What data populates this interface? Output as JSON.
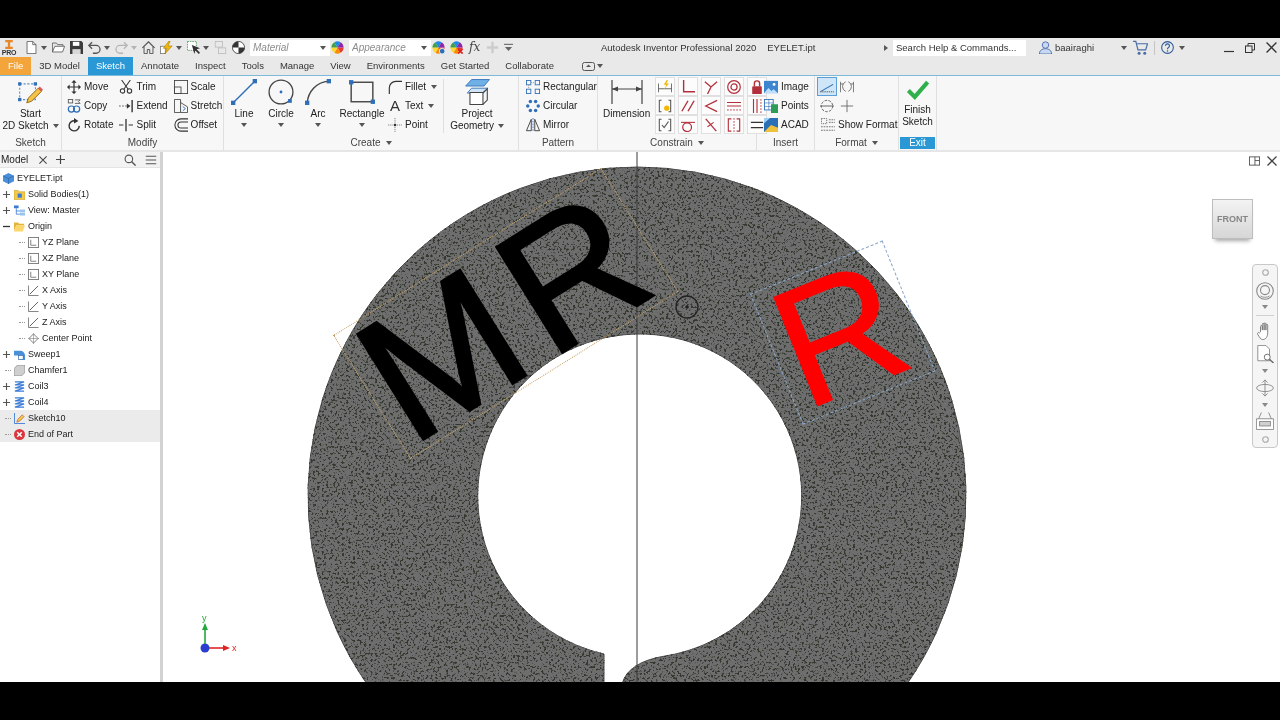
{
  "window": {
    "edition_badge": "PRO",
    "title": "Autodesk Inventor Professional 2020",
    "document": "EYELET.ipt"
  },
  "quick_access": [
    {
      "kind": "button",
      "disabled": false,
      "dropdown": true
    },
    {
      "kind": "button",
      "disabled": false,
      "dropdown": false
    },
    {
      "kind": "button",
      "disabled": false,
      "dropdown": false
    },
    {
      "kind": "button",
      "disabled": false,
      "dropdown": true
    },
    {
      "kind": "button",
      "disabled": true,
      "dropdown": true
    },
    {
      "kind": "button",
      "disabled": false,
      "dropdown": false
    },
    {
      "kind": "button",
      "disabled": false,
      "dropdown": true
    },
    {
      "kind": "button",
      "disabled": false,
      "dropdown": true
    },
    {
      "kind": "button",
      "disabled": true,
      "dropdown": false
    },
    {
      "kind": "button",
      "disabled": false,
      "dropdown": false
    },
    {
      "kind": "combo",
      "placeholder": "Material"
    },
    {
      "kind": "button",
      "disabled": false,
      "dropdown": false
    },
    {
      "kind": "combo",
      "placeholder": "Appearance"
    },
    {
      "kind": "button",
      "disabled": false,
      "dropdown": false
    },
    {
      "kind": "button",
      "disabled": false,
      "dropdown": false
    },
    {
      "kind": "glyph",
      "label": "fx"
    },
    {
      "kind": "button",
      "disabled": true,
      "dropdown": false
    },
    {
      "kind": "menu"
    }
  ],
  "search": {
    "placeholder": "Search Help & Commands..."
  },
  "account": {
    "user": "baairaghi"
  },
  "tabs": [
    {
      "kind": "file",
      "label": "File",
      "selected": false
    },
    {
      "kind": "tab",
      "label": "3D Model",
      "selected": false
    },
    {
      "kind": "tab",
      "label": "Sketch",
      "selected": true
    },
    {
      "kind": "tab",
      "label": "Annotate",
      "selected": false
    },
    {
      "kind": "tab",
      "label": "Inspect",
      "selected": false
    },
    {
      "kind": "tab",
      "label": "Tools",
      "selected": false
    },
    {
      "kind": "tab",
      "label": "Manage",
      "selected": false
    },
    {
      "kind": "tab",
      "label": "View",
      "selected": false
    },
    {
      "kind": "tab",
      "label": "Environments",
      "selected": false
    },
    {
      "kind": "tab",
      "label": "Get Started",
      "selected": false
    },
    {
      "kind": "tab",
      "label": "Collaborate",
      "selected": false
    }
  ],
  "ribbon": [
    {
      "kind": "standard",
      "title": "Sketch",
      "menu": false,
      "tools": [
        {
          "kind": "stacked",
          "label": "Start\n2D Sketch",
          "dropdown": true
        }
      ]
    },
    {
      "kind": "standard",
      "title": "Modify",
      "menu": false,
      "tools": [
        {
          "kind": "small",
          "label": "Move",
          "dropdown": false
        },
        {
          "kind": "small",
          "label": "Copy",
          "dropdown": false
        },
        {
          "kind": "small",
          "label": "Rotate",
          "dropdown": false
        },
        {
          "kind": "small",
          "label": "Trim",
          "dropdown": false
        },
        {
          "kind": "small",
          "label": "Extend",
          "dropdown": false
        },
        {
          "kind": "small",
          "label": "Split",
          "dropdown": false
        },
        {
          "kind": "small",
          "label": "Scale",
          "dropdown": false
        },
        {
          "kind": "small",
          "label": "Stretch",
          "dropdown": false
        },
        {
          "kind": "small",
          "label": "Offset",
          "dropdown": false
        }
      ]
    },
    {
      "kind": "standard",
      "title": "Create",
      "menu": true,
      "tools": [
        {
          "kind": "large",
          "label": "Line",
          "dropdown": true
        },
        {
          "kind": "large",
          "label": "Circle",
          "dropdown": true
        },
        {
          "kind": "large",
          "label": "Arc",
          "dropdown": true
        },
        {
          "kind": "large",
          "label": "Rectangle",
          "dropdown": true
        },
        {
          "kind": "small",
          "label": "Fillet",
          "dropdown": true
        },
        {
          "kind": "small",
          "label": "Text",
          "dropdown": true,
          "glyph": "A"
        },
        {
          "kind": "small",
          "label": "Point",
          "dropdown": false
        },
        {
          "kind": "separator"
        },
        {
          "kind": "stacked",
          "label": "Project\nGeometry",
          "dropdown": true
        }
      ]
    },
    {
      "kind": "standard",
      "title": "Pattern",
      "menu": false,
      "tools": [
        {
          "kind": "small",
          "label": "Rectangular",
          "dropdown": false
        },
        {
          "kind": "small",
          "label": "Circular",
          "dropdown": false
        },
        {
          "kind": "small",
          "label": "Mirror",
          "dropdown": false
        }
      ]
    },
    {
      "kind": "standard",
      "title": "Constrain",
      "menu": true,
      "tools": [
        {
          "kind": "large",
          "label": "Dimension",
          "dropdown": false
        },
        {
          "kind": "icon"
        },
        {
          "kind": "icon"
        },
        {
          "kind": "icon"
        },
        {
          "kind": "icon"
        },
        {
          "kind": "icon"
        },
        {
          "kind": "icon"
        },
        {
          "kind": "icon"
        },
        {
          "kind": "icon"
        },
        {
          "kind": "icon"
        },
        {
          "kind": "icon"
        },
        {
          "kind": "icon"
        },
        {
          "kind": "icon"
        },
        {
          "kind": "icon"
        },
        {
          "kind": "icon"
        },
        {
          "kind": "icon"
        }
      ]
    },
    {
      "kind": "standard",
      "title": "Insert",
      "menu": false,
      "tools": [
        {
          "kind": "small",
          "label": "Image",
          "dropdown": false
        },
        {
          "kind": "small",
          "label": "Points",
          "dropdown": false
        },
        {
          "kind": "small",
          "label": "ACAD",
          "dropdown": false
        }
      ]
    },
    {
      "kind": "grid",
      "title": "Format",
      "menu": true,
      "tools": [
        {
          "kind": "icon",
          "on": true
        },
        {
          "kind": "icon",
          "on": false
        },
        {
          "kind": "icon",
          "on": false
        },
        {
          "kind": "icon",
          "on": false
        },
        {
          "kind": "small",
          "label": "Show Format",
          "dropdown": false
        }
      ]
    },
    {
      "kind": "exit",
      "title": "Exit",
      "menu": false,
      "tools": [
        {
          "kind": "stacked",
          "label": "Finish\nSketch",
          "dropdown": false
        }
      ]
    }
  ],
  "browser": {
    "tab": "Model",
    "tree": [
      {
        "label": "EYELET.ipt",
        "kind": "part",
        "highlighted": false,
        "children": [
          {
            "label": "Solid Bodies(1)",
            "kind": "bodies",
            "expanded": false,
            "highlighted": false
          },
          {
            "label": "View: Master",
            "kind": "view",
            "expanded": false,
            "highlighted": false
          },
          {
            "label": "Origin",
            "kind": "folder",
            "expanded": true,
            "highlighted": false,
            "children": [
              {
                "label": "YZ Plane",
                "kind": "plane",
                "highlighted": false
              },
              {
                "label": "XZ Plane",
                "kind": "plane",
                "highlighted": false
              },
              {
                "label": "XY Plane",
                "kind": "plane",
                "highlighted": false
              },
              {
                "label": "X Axis",
                "kind": "axis",
                "highlighted": false
              },
              {
                "label": "Y Axis",
                "kind": "axis",
                "highlighted": false
              },
              {
                "label": "Z Axis",
                "kind": "axis",
                "highlighted": false
              },
              {
                "label": "Center Point",
                "kind": "point",
                "highlighted": false
              }
            ]
          },
          {
            "label": "Sweep1",
            "kind": "sweep",
            "expanded": false,
            "highlighted": false
          },
          {
            "label": "Chamfer1",
            "kind": "chamfer",
            "highlighted": false
          },
          {
            "label": "Coil3",
            "kind": "coil",
            "expanded": false,
            "highlighted": false
          },
          {
            "label": "Coil4",
            "kind": "coil",
            "expanded": false,
            "highlighted": false
          },
          {
            "label": "Sketch10",
            "kind": "sketch",
            "highlighted": true
          },
          {
            "label": "End of Part",
            "kind": "end",
            "highlighted": true
          }
        ]
      }
    ]
  },
  "viewport": {
    "sketch_texts": [
      {
        "kind": "arc",
        "text": "MR",
        "highlighted": false
      },
      {
        "kind": "straight",
        "text": "R",
        "highlighted": true
      }
    ],
    "view_cube": {
      "face": "FRONT"
    },
    "triad": [
      {
        "label": "y",
        "color": "#22a83a"
      },
      {
        "label": "x",
        "color": "#e02424"
      }
    ]
  }
}
